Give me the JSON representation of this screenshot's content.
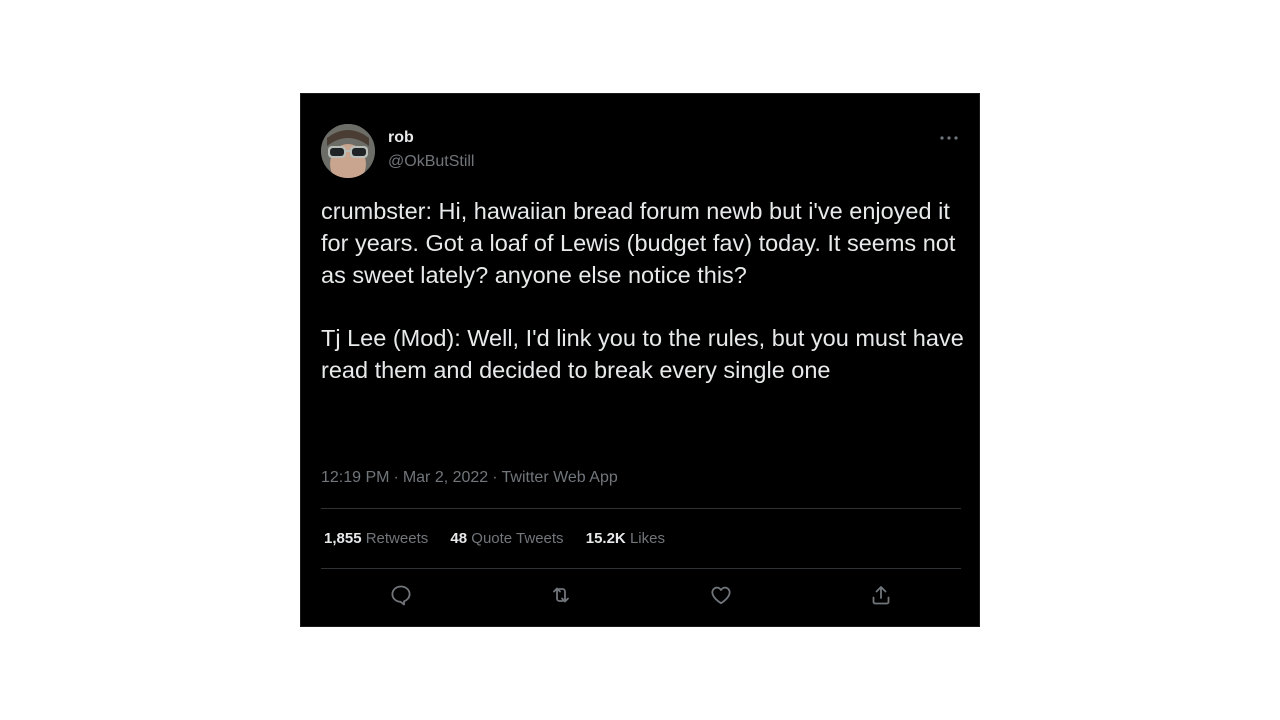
{
  "tweet": {
    "author": {
      "display_name": "rob",
      "handle": "@OkButStill",
      "avatar_icon": "avatar-photo"
    },
    "paragraphs": [
      "crumbster: Hi, hawaiian bread forum newb but i've enjoyed it for years. Got a loaf of Lewis (budget fav) today. It seems not as sweet lately? anyone else notice this?",
      "Tj Lee (Mod): Well, I'd link you to the rules, but you must have read them and decided to break every single one"
    ],
    "time": "12:19 PM",
    "date": "Mar 2, 2022",
    "source": "Twitter Web App",
    "separator": "·",
    "stats": {
      "retweets": {
        "count": "1,855",
        "label": "Retweets"
      },
      "quote_tweets": {
        "count": "48",
        "label": "Quote Tweets"
      },
      "likes": {
        "count": "15.2K",
        "label": "Likes"
      }
    },
    "actions": [
      "reply-icon",
      "retweet-icon",
      "like-icon",
      "share-icon"
    ],
    "more_icon": "more-icon"
  },
  "colors": {
    "background": "#000000",
    "text_primary": "#e7e9ea",
    "text_secondary": "#71767b",
    "divider": "#2f3336",
    "page_background": "#ffffff"
  }
}
